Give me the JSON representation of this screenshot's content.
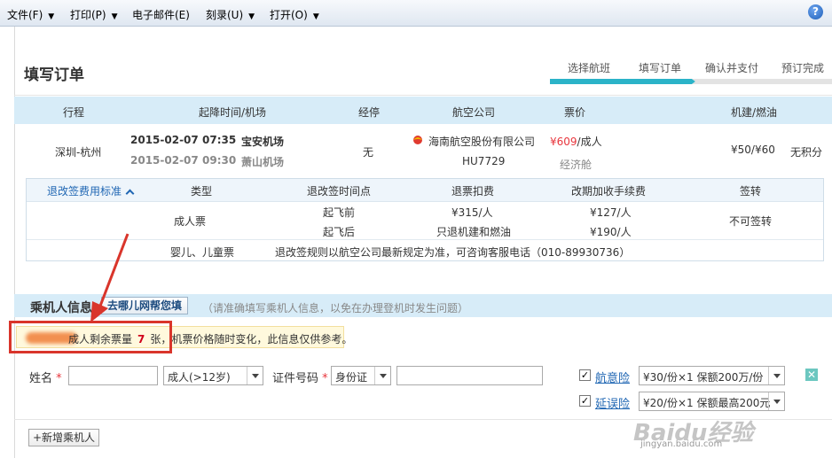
{
  "menubar": {
    "items": [
      {
        "label": "文件(F)"
      },
      {
        "label": "打印(P)"
      },
      {
        "label": "电子邮件(E)"
      },
      {
        "label": "刻录(U)"
      },
      {
        "label": "打开(O)"
      }
    ],
    "help_label": "?"
  },
  "order": {
    "title": "填写订单",
    "steps": [
      "选择航班",
      "填写订单",
      "确认并支付",
      "预订完成"
    ],
    "current_step_index": 1
  },
  "flight_table": {
    "headers": [
      "行程",
      "起降时间/机场",
      "经停",
      "航空公司",
      "票价",
      "机建/燃油"
    ],
    "route": "深圳-杭州",
    "depart": {
      "date": "2015-02-07",
      "time": "07:35",
      "airport": "宝安机场"
    },
    "arrive": {
      "date": "2015-02-07",
      "time": "09:30",
      "airport": "萧山机场"
    },
    "stops": "无",
    "airline": "海南航空股份有限公司",
    "flight_no": "HU7729",
    "price": "¥609",
    "price_unit": "/成人",
    "cabin": "经济舱",
    "tax": "¥50/¥60",
    "points": "无积分"
  },
  "refund_table": {
    "toggle_label": "退改签费用标准",
    "headers": [
      "类型",
      "退改签时间点",
      "退票扣费",
      "改期加收手续费",
      "签转"
    ],
    "adult_label": "成人票",
    "rows": [
      {
        "time": "起飞前",
        "refund": "¥315/人",
        "change": "¥127/人"
      },
      {
        "time": "起飞后",
        "refund": "只退机建和燃油",
        "change": "¥190/人"
      }
    ],
    "transfer": "不可签转",
    "child_label": "婴儿、儿童票",
    "child_note": "退改签规则以航空公司最新规定为准，可咨询客服电话（010-89930736）"
  },
  "passenger": {
    "section_title": "乘机人信息",
    "help_button": "去哪儿网帮您填",
    "hint": "（请准确填写乘机人信息，以免在办理登机时发生问题）",
    "note_prefix": "成人剩余票量",
    "note_count": "7",
    "note_suffix": "张，机票价格随时变化，此信息仅供参考。",
    "name_label": "姓名",
    "type_select": "成人(>12岁)",
    "id_label": "证件号码",
    "id_type_select": "身份证",
    "insurance1_label": "航意险",
    "insurance1_select": "¥30/份×1 保额200万/份",
    "insurance2_label": "延误险",
    "insurance2_select": "¥20/份×1 保额最高200元",
    "add_button": "新增乘机人"
  },
  "watermark": {
    "text": "Baidu经验",
    "sub": "jingyan.baidu.com"
  },
  "colors": {
    "accent": "#2bb3c8",
    "header_bg": "#d7ecf8",
    "price": "#e8353c",
    "annotation": "#d9352b"
  }
}
